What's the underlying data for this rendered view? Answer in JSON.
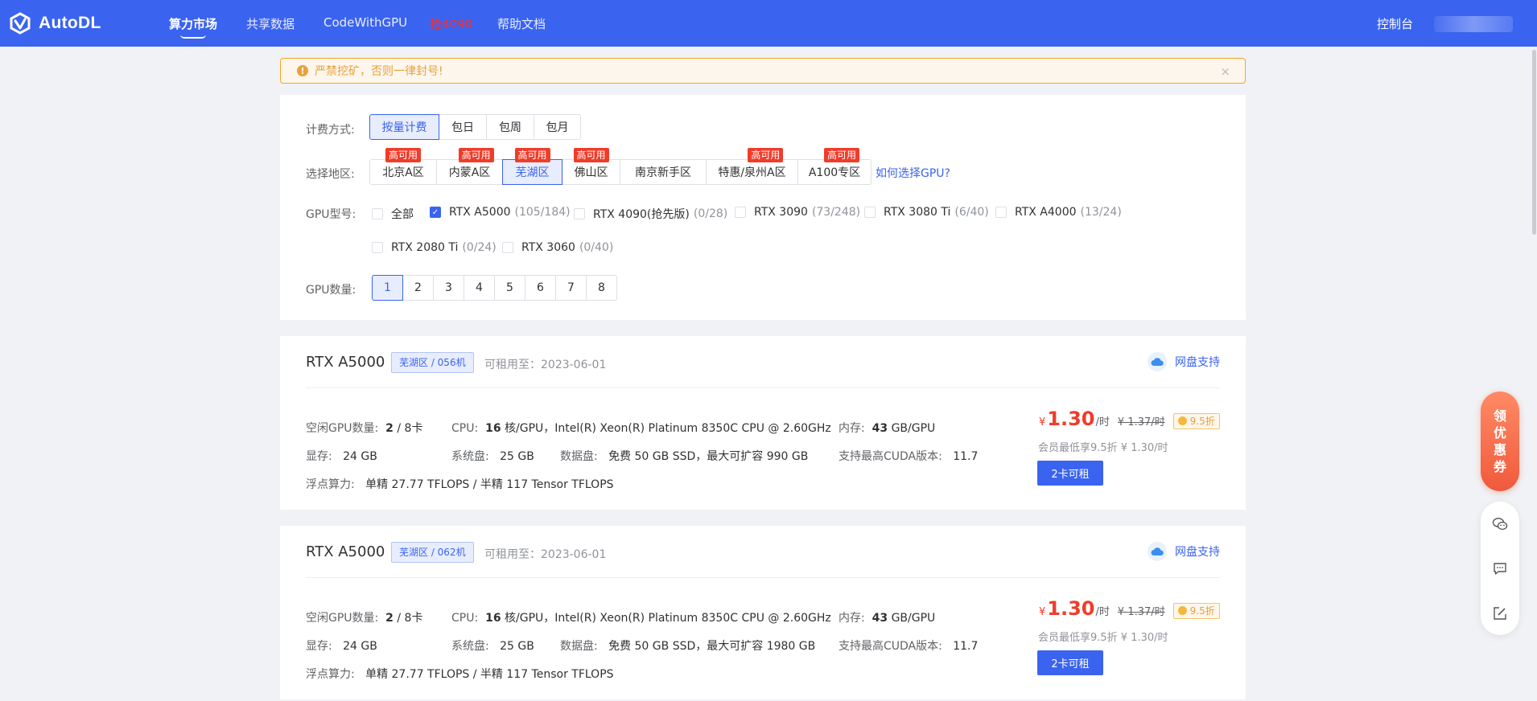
{
  "nav": {
    "brand": "AutoDL",
    "items": [
      {
        "label": "算力市场",
        "active": true
      },
      {
        "label": "共享数据"
      },
      {
        "label": "CodeWithGPU"
      },
      {
        "label": "抢4090",
        "hot": true
      },
      {
        "label": "帮助文档"
      }
    ],
    "console": "控制台"
  },
  "warning": {
    "text": "严禁挖矿，否则一律封号!",
    "close": "×"
  },
  "filter": {
    "billing_label": "计费方式:",
    "billing_options": [
      "按量计费",
      "包日",
      "包周",
      "包月"
    ],
    "billing_selected": "按量计费",
    "region_label": "选择地区:",
    "regions": [
      {
        "label": "北京A区",
        "tag": "高可用"
      },
      {
        "label": "内蒙A区",
        "tag": "高可用"
      },
      {
        "label": "芜湖区",
        "tag": "高可用",
        "active": true
      },
      {
        "label": "佛山区",
        "tag": "高可用"
      },
      {
        "label": "南京新手区"
      },
      {
        "label": "特惠/泉州A区",
        "tag": "高可用"
      },
      {
        "label": "A100专区",
        "tag": "高可用"
      }
    ],
    "help_link": "如何选择GPU?",
    "gpu_label": "GPU型号:",
    "gpu_types": [
      {
        "label": "全部",
        "count": ""
      },
      {
        "label": "RTX A5000",
        "count": "(105/184)",
        "checked": true
      },
      {
        "label": "RTX 4090(抢先版)",
        "count": "(0/28)"
      },
      {
        "label": "RTX 3090",
        "count": "(73/248)"
      },
      {
        "label": "RTX 3080 Ti",
        "count": "(6/40)"
      },
      {
        "label": "RTX A4000",
        "count": "(13/24)"
      },
      {
        "label": "RTX 2080 Ti",
        "count": "(0/24)"
      },
      {
        "label": "RTX 3060",
        "count": "(0/40)"
      }
    ],
    "gpu_count_label": "GPU数量:",
    "gpu_counts": [
      "1",
      "2",
      "3",
      "4",
      "5",
      "6",
      "7",
      "8"
    ],
    "gpu_count_selected": "1"
  },
  "machines": [
    {
      "gpu": "RTX A5000",
      "region_tag": "芜湖区 / 056机",
      "available": "可租用至：2023-06-01",
      "disk_support": "网盘支持",
      "free_gpu_label": "空闲GPU数量:",
      "free_gpu": "2",
      "total_gpu": "/ 8卡",
      "cpu_label": "CPU:",
      "cpu_cores": "16",
      "cpu_desc": "核/GPU，Intel(R) Xeon(R) Platinum 8350C CPU @ 2.60GHz",
      "mem_label": "内存:",
      "mem_value": "43",
      "mem_unit": "GB/GPU",
      "vram_label": "显存:",
      "vram": "24 GB",
      "sysdisk_label": "系统盘:",
      "sysdisk": "25 GB",
      "datadisk_label": "数据盘:",
      "datadisk": "免费 50 GB SSD，最大可扩容 990 GB",
      "cuda_label": "支持最高CUDA版本:",
      "cuda": "11.7",
      "flops_label": "浮点算力:",
      "flops": "单精 27.77 TFLOPS / 半精 117 Tensor TFLOPS",
      "price_currency": "¥",
      "price": "1.30",
      "price_unit": "/时",
      "price_old": "¥ 1.37/时",
      "discount": "9.5折",
      "member_price": "会员最低享9.5折 ¥ 1.30/时",
      "rent_button": "2卡可租"
    },
    {
      "gpu": "RTX A5000",
      "region_tag": "芜湖区 / 062机",
      "available": "可租用至：2023-06-01",
      "disk_support": "网盘支持",
      "free_gpu_label": "空闲GPU数量:",
      "free_gpu": "2",
      "total_gpu": "/ 8卡",
      "cpu_label": "CPU:",
      "cpu_cores": "16",
      "cpu_desc": "核/GPU，Intel(R) Xeon(R) Platinum 8350C CPU @ 2.60GHz",
      "mem_label": "内存:",
      "mem_value": "43",
      "mem_unit": "GB/GPU",
      "vram_label": "显存:",
      "vram": "24 GB",
      "sysdisk_label": "系统盘:",
      "sysdisk": "25 GB",
      "datadisk_label": "数据盘:",
      "datadisk": "免费 50 GB SSD，最大可扩容 1980 GB",
      "cuda_label": "支持最高CUDA版本:",
      "cuda": "11.7",
      "flops_label": "浮点算力:",
      "flops": "单精 27.77 TFLOPS / 半精 117 Tensor TFLOPS",
      "price_currency": "¥",
      "price": "1.30",
      "price_unit": "/时",
      "price_old": "¥ 1.37/时",
      "discount": "9.5折",
      "member_price": "会员最低享9.5折 ¥ 1.30/时",
      "rent_button": "2卡可租"
    }
  ],
  "side": {
    "coupon": [
      "领",
      "优",
      "惠",
      "券"
    ]
  },
  "icons": {
    "logo": "autodl-logo-icon",
    "warning": "warning-circle-icon",
    "cloud": "cloud-icon",
    "wechat": "wechat-icon",
    "chat": "chat-icon",
    "feedback": "edit-icon"
  },
  "colors": {
    "primary": "#3a63f0",
    "danger": "#f03c2a",
    "warning": "#e6a23c"
  }
}
